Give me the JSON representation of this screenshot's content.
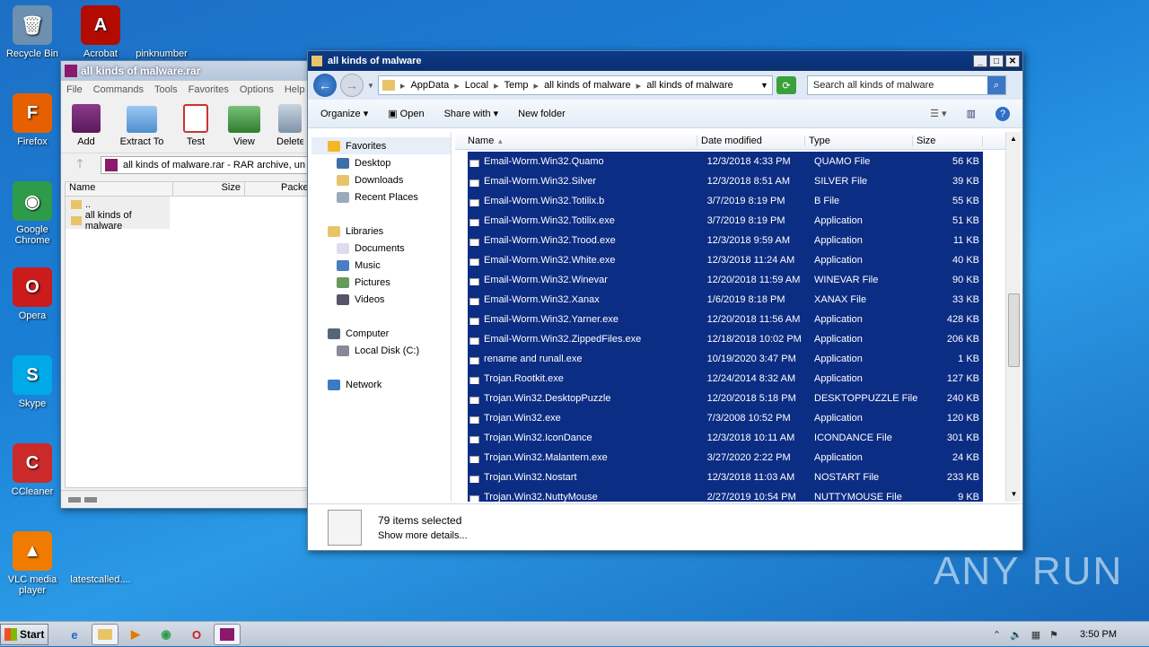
{
  "desktop": {
    "icons": [
      {
        "label": "Recycle Bin",
        "glyph": "🗑",
        "color": "#6d8fb0"
      },
      {
        "label": "Acrobat",
        "glyph": "A",
        "color": "#b30b00"
      },
      {
        "label": "pinknumber",
        "glyph": "",
        "color": "transparent"
      },
      {
        "label": "Firefox",
        "glyph": "F",
        "color": "#e66000"
      },
      {
        "label": "Google Chrome",
        "glyph": "◉",
        "color": "#2e9b4a"
      },
      {
        "label": "Opera",
        "glyph": "O",
        "color": "#cc1b1b"
      },
      {
        "label": "Skype",
        "glyph": "S",
        "color": "#00a9e8"
      },
      {
        "label": "CCleaner",
        "glyph": "C",
        "color": "#cc2a2a"
      },
      {
        "label": "VLC media player",
        "glyph": "▲",
        "color": "#f07b00"
      },
      {
        "label": "latestcalled....",
        "glyph": "",
        "color": "transparent"
      }
    ]
  },
  "winrar": {
    "title": "all kinds of malware.rar",
    "menu": [
      "File",
      "Commands",
      "Tools",
      "Favorites",
      "Options",
      "Help"
    ],
    "toolbar": [
      "Add",
      "Extract To",
      "Test",
      "View",
      "Delete"
    ],
    "path": "all kinds of malware.rar - RAR archive, un",
    "columns": [
      "Name",
      "Size",
      "Packed"
    ],
    "rows": [
      "..",
      "all kinds of malware"
    ]
  },
  "explorer": {
    "title": "all kinds of malware",
    "breadcrumb": [
      "AppData",
      "Local",
      "Temp",
      "all kinds of malware",
      "all kinds of malware"
    ],
    "search_placeholder": "Search all kinds of malware",
    "commands": {
      "organize": "Organize",
      "open": "Open",
      "share": "Share with",
      "new_folder": "New folder"
    },
    "nav": {
      "favorites": "Favorites",
      "fav_items": [
        "Desktop",
        "Downloads",
        "Recent Places"
      ],
      "libraries": "Libraries",
      "lib_items": [
        "Documents",
        "Music",
        "Pictures",
        "Videos"
      ],
      "computer": "Computer",
      "comp_items": [
        "Local Disk (C:)"
      ],
      "network": "Network"
    },
    "columns": {
      "name": "Name",
      "date": "Date modified",
      "type": "Type",
      "size": "Size"
    },
    "files": [
      {
        "name": "Email-Worm.Win32.Quamo",
        "date": "12/3/2018 4:33 PM",
        "type": "QUAMO File",
        "size": "56 KB"
      },
      {
        "name": "Email-Worm.Win32.Silver",
        "date": "12/3/2018 8:51 AM",
        "type": "SILVER File",
        "size": "39 KB"
      },
      {
        "name": "Email-Worm.Win32.Totilix.b",
        "date": "3/7/2019 8:19 PM",
        "type": "B File",
        "size": "55 KB"
      },
      {
        "name": "Email-Worm.Win32.Totilix.exe",
        "date": "3/7/2019 8:19 PM",
        "type": "Application",
        "size": "51 KB"
      },
      {
        "name": "Email-Worm.Win32.Trood.exe",
        "date": "12/3/2018 9:59 AM",
        "type": "Application",
        "size": "11 KB"
      },
      {
        "name": "Email-Worm.Win32.White.exe",
        "date": "12/3/2018 11:24 AM",
        "type": "Application",
        "size": "40 KB"
      },
      {
        "name": "Email-Worm.Win32.Winevar",
        "date": "12/20/2018 11:59 AM",
        "type": "WINEVAR File",
        "size": "90 KB"
      },
      {
        "name": "Email-Worm.Win32.Xanax",
        "date": "1/6/2019 8:18 PM",
        "type": "XANAX File",
        "size": "33 KB"
      },
      {
        "name": "Email-Worm.Win32.Yarner.exe",
        "date": "12/20/2018 11:56 AM",
        "type": "Application",
        "size": "428 KB"
      },
      {
        "name": "Email-Worm.Win32.ZippedFiles.exe",
        "date": "12/18/2018 10:02 PM",
        "type": "Application",
        "size": "206 KB"
      },
      {
        "name": "rename and runall.exe",
        "date": "10/19/2020 3:47 PM",
        "type": "Application",
        "size": "1 KB"
      },
      {
        "name": "Trojan.Rootkit.exe",
        "date": "12/24/2014 8:32 AM",
        "type": "Application",
        "size": "127 KB"
      },
      {
        "name": "Trojan.Win32.DesktopPuzzle",
        "date": "12/20/2018 5:18 PM",
        "type": "DESKTOPPUZZLE File",
        "size": "240 KB"
      },
      {
        "name": "Trojan.Win32.exe",
        "date": "7/3/2008 10:52 PM",
        "type": "Application",
        "size": "120 KB"
      },
      {
        "name": "Trojan.Win32.IconDance",
        "date": "12/3/2018 10:11 AM",
        "type": "ICONDANCE File",
        "size": "301 KB"
      },
      {
        "name": "Trojan.Win32.Malantern.exe",
        "date": "3/27/2020 2:22 PM",
        "type": "Application",
        "size": "24 KB"
      },
      {
        "name": "Trojan.Win32.Nostart",
        "date": "12/3/2018 11:03 AM",
        "type": "NOSTART File",
        "size": "233 KB"
      },
      {
        "name": "Trojan.Win32.NuttyMouse",
        "date": "2/27/2019 10:54 PM",
        "type": "NUTTYMOUSE File",
        "size": "9 KB"
      }
    ],
    "status": {
      "count": "79 items selected",
      "details": "Show more details..."
    }
  },
  "taskbar": {
    "start": "Start",
    "clock": "3:50 PM"
  },
  "watermark": "ANY RUN"
}
